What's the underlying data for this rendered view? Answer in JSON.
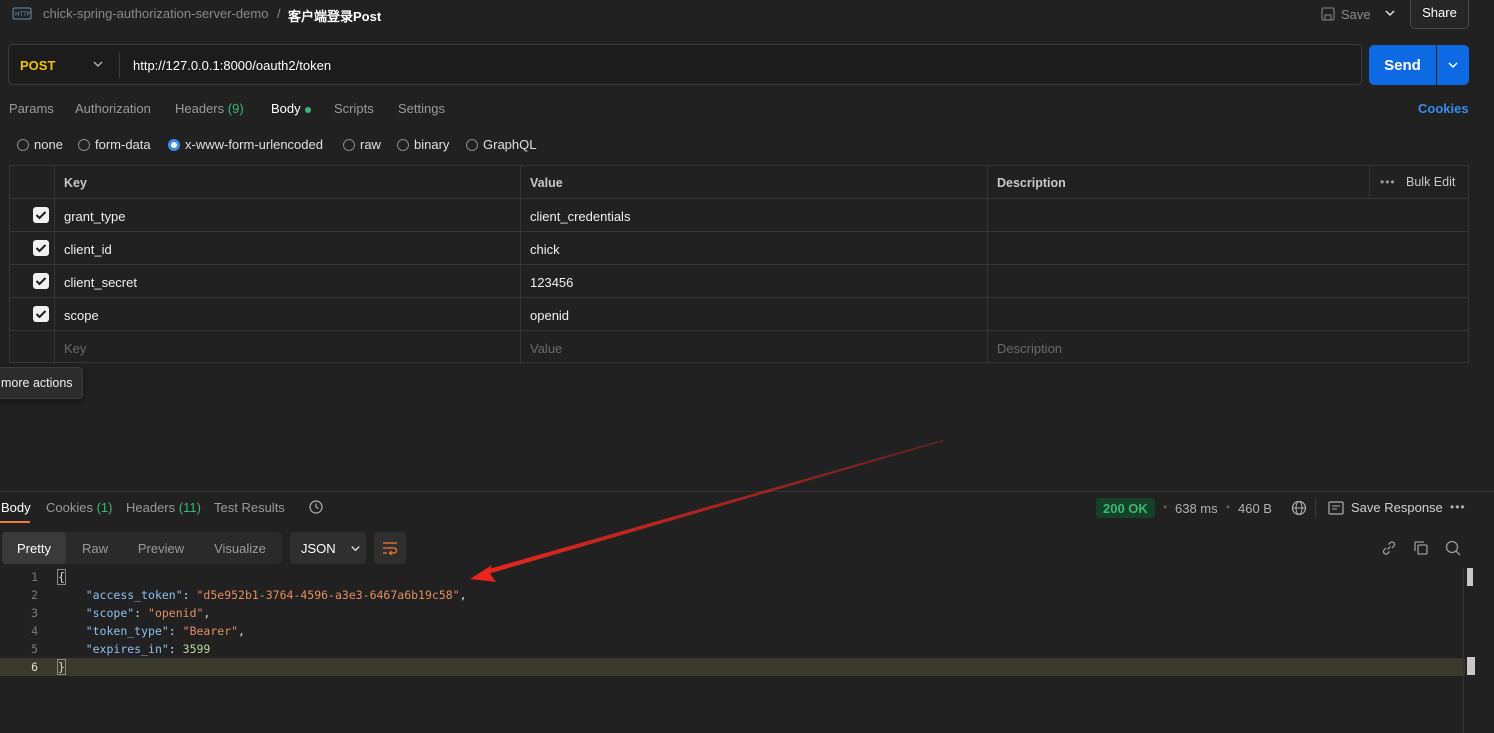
{
  "topbar": {
    "collection": "chick-spring-authorization-server-demo",
    "separator": "/",
    "request_name": "客户端登录Post",
    "save_label": "Save",
    "share_label": "Share"
  },
  "request": {
    "method": "POST",
    "url": "http://127.0.0.1:8000/oauth2/token",
    "send_label": "Send"
  },
  "req_tabs": {
    "params": "Params",
    "authorization": "Authorization",
    "headers": "Headers",
    "headers_count": "(9)",
    "body": "Body",
    "scripts": "Scripts",
    "settings": "Settings",
    "cookies": "Cookies"
  },
  "body_types": [
    "none",
    "form-data",
    "x-www-form-urlencoded",
    "raw",
    "binary",
    "GraphQL"
  ],
  "body_type_selected": "x-www-form-urlencoded",
  "params_table": {
    "headers": {
      "key": "Key",
      "value": "Value",
      "description": "Description",
      "bulk_edit": "Bulk Edit",
      "more": "•••"
    },
    "rows": [
      {
        "key": "grant_type",
        "value": "client_credentials",
        "checked": true
      },
      {
        "key": "client_id",
        "value": "chick",
        "checked": true
      },
      {
        "key": "client_secret",
        "value": "123456",
        "checked": true
      },
      {
        "key": "scope",
        "value": "openid",
        "checked": true
      }
    ],
    "placeholder": {
      "key": "Key",
      "value": "Value",
      "description": "Description"
    }
  },
  "tooltip": "more actions",
  "response": {
    "tabs": {
      "body": "Body",
      "cookies": "Cookies",
      "cookies_count": "(1)",
      "headers": "Headers",
      "headers_count": "(11)",
      "test_results": "Test Results"
    },
    "status": "200 OK",
    "time": "638 ms",
    "size": "460 B",
    "save_response": "Save Response",
    "more": "•••",
    "views": [
      "Pretty",
      "Raw",
      "Preview",
      "Visualize"
    ],
    "format": "JSON",
    "code_lines": [
      {
        "num": "1"
      },
      {
        "num": "2",
        "key": "\"access_token\"",
        "str": "\"d5e952b1-3764-4596-a3e3-6467a6b19c58\""
      },
      {
        "num": "3",
        "key": "\"scope\"",
        "str": "\"openid\""
      },
      {
        "num": "4",
        "key": "\"token_type\"",
        "str": "\"Bearer\""
      },
      {
        "num": "5",
        "key": "\"expires_in\"",
        "num_val": "3599"
      },
      {
        "num": "6"
      }
    ]
  },
  "colors": {
    "background": "#212121",
    "accent_blue": "#0d6ae3",
    "method_yellow": "#f5c300",
    "success_green": "#3db873",
    "arrow_red": "#e8261e"
  }
}
